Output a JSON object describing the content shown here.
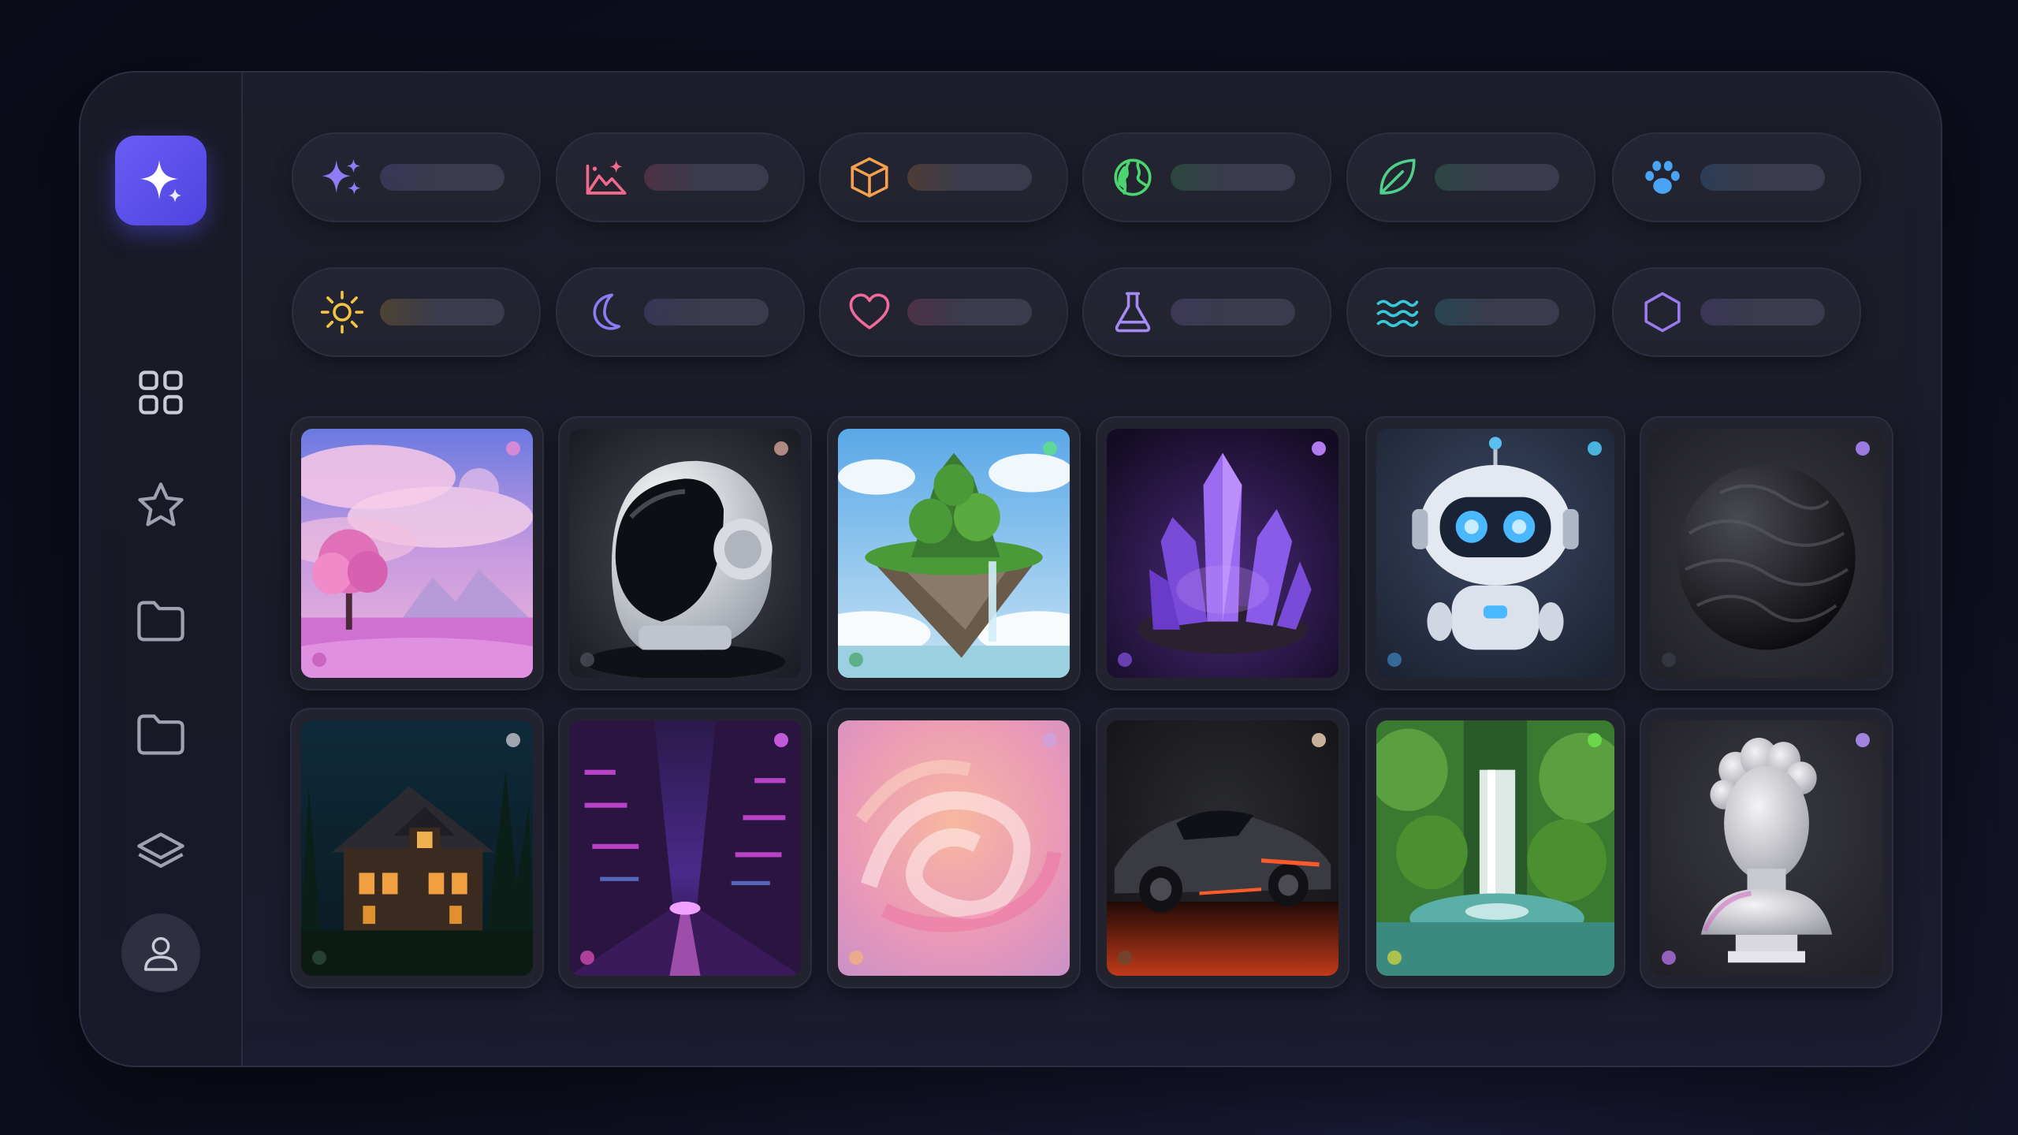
{
  "colors": {
    "accent": "#5b4fea",
    "background": "#0f1020",
    "panel": "#1d1e2a",
    "pill_bar": "#3a3b4c"
  },
  "sidebar": {
    "logo_icon": "sparkle-icon",
    "items": [
      {
        "icon": "grid-icon"
      },
      {
        "icon": "star-icon"
      },
      {
        "icon": "folder-icon"
      },
      {
        "icon": "folder-icon"
      },
      {
        "icon": "layers-icon"
      }
    ],
    "profile_icon": "user-icon"
  },
  "categories": [
    {
      "icon": "sparkles-icon",
      "color": "#8f7cf4"
    },
    {
      "icon": "image-icon",
      "color": "#ef6a8a"
    },
    {
      "icon": "cube-icon",
      "color": "#f4a04e"
    },
    {
      "icon": "globe-icon",
      "color": "#4cd46f"
    },
    {
      "icon": "leaf-icon",
      "color": "#4fd08a"
    },
    {
      "icon": "paw-icon",
      "color": "#4aa3f3"
    },
    {
      "icon": "sun-icon",
      "color": "#f2c443"
    },
    {
      "icon": "moon-icon",
      "color": "#8a7cf2"
    },
    {
      "icon": "heart-icon",
      "color": "#f06a9a"
    },
    {
      "icon": "flask-icon",
      "color": "#a58af2"
    },
    {
      "icon": "waves-icon",
      "color": "#38c9d9"
    },
    {
      "icon": "hexagon-icon",
      "color": "#9a7af0"
    }
  ],
  "gallery": [
    {
      "subject": "pink-tree-landscape-image",
      "dot": "#d58ad8",
      "dot2": "#c45ab8"
    },
    {
      "subject": "astronaut-helmet-image",
      "dot": "#b08a80",
      "dot2": "#4a4d58"
    },
    {
      "subject": "floating-island-image",
      "dot": "#5fd69a",
      "dot2": "#4fa870"
    },
    {
      "subject": "purple-crystal-image",
      "dot": "#b07af0",
      "dot2": "#7a4ad0"
    },
    {
      "subject": "cute-robot-image",
      "dot": "#4ab3e0",
      "dot2": "#3a7ab0"
    },
    {
      "subject": "black-sphere-image",
      "dot": "#9a7ae0",
      "dot2": "#3a3b46"
    },
    {
      "subject": "night-cabin-image",
      "dot": "#a0a4b0",
      "dot2": "#2c4a3a"
    },
    {
      "subject": "neon-city-street-image",
      "dot": "#c05ad8",
      "dot2": "#d04ab0"
    },
    {
      "subject": "pink-swirl-image",
      "dot": "#d0a0d8",
      "dot2": "#f0b080"
    },
    {
      "subject": "sports-car-image",
      "dot": "#c8b09a",
      "dot2": "#6a4a30"
    },
    {
      "subject": "jungle-waterfall-image",
      "dot": "#6ad84a",
      "dot2": "#c8d040"
    },
    {
      "subject": "marble-bust-image",
      "dot": "#a084e0",
      "dot2": "#b070e0"
    }
  ]
}
